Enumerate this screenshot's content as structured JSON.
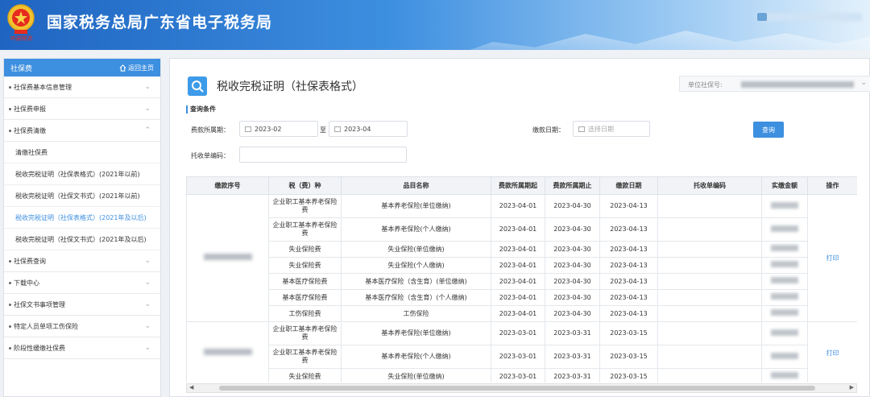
{
  "header": {
    "site_title": "国家税务总局广东省电子税务局",
    "emblem_sub": "中国税务"
  },
  "sidebar": {
    "title": "社保费",
    "home_label": "返回主页",
    "items": [
      {
        "label": "社保费基本信息管理",
        "chevron": "chevron-down-icon"
      },
      {
        "label": "社保费申报",
        "chevron": "chevron-down-icon"
      },
      {
        "label": "社保费清缴",
        "chevron": "chevron-up-icon"
      }
    ],
    "sub_items": [
      {
        "label": "清缴社保费"
      },
      {
        "label": "税收完税证明（社保表格式）(2021年以前)"
      },
      {
        "label": "税收完税证明（社保文书式）(2021年以前)"
      },
      {
        "label": "税收完税证明（社保表格式）(2021年及以后)",
        "active": true
      },
      {
        "label": "税收完税证明（社保文书式）(2021年及以后)"
      }
    ],
    "items_after": [
      {
        "label": "社保费查询"
      },
      {
        "label": "下载中心"
      },
      {
        "label": "社保文书事项管理"
      },
      {
        "label": "特定人员单项工伤保险"
      },
      {
        "label": "阶段性缓缴社保费"
      }
    ]
  },
  "main": {
    "title": "税收完税证明（社保表格式）",
    "unit_label": "单位社保号:",
    "section_label": "查询条件",
    "period_label": "费款所属期：",
    "period_start": "2023-02",
    "period_to": "至",
    "period_end": "2023-04",
    "pay_date_label": "缴款日期：",
    "pay_date_placeholder": "选择日期",
    "query_button": "查询",
    "entrust_label": "托收单编码："
  },
  "table": {
    "headers": [
      "缴款序号",
      "税（费）种",
      "品目名称",
      "费款所属期起",
      "费款所属期止",
      "缴款日期",
      "托收单编码",
      "实缴金额",
      "操作"
    ],
    "print_label": "打印",
    "group1_rows": [
      {
        "tax": "企业职工基本养老保险费",
        "item": "基本养老保险(单位缴纳)",
        "start": "2023-04-01",
        "end": "2023-04-30",
        "date": "2023-04-13"
      },
      {
        "tax": "企业职工基本养老保险费",
        "item": "基本养老保险(个人缴纳)",
        "start": "2023-04-01",
        "end": "2023-04-30",
        "date": "2023-04-13"
      },
      {
        "tax": "失业保险费",
        "item": "失业保险(单位缴纳)",
        "start": "2023-04-01",
        "end": "2023-04-30",
        "date": "2023-04-13"
      },
      {
        "tax": "失业保险费",
        "item": "失业保险(个人缴纳)",
        "start": "2023-04-01",
        "end": "2023-04-30",
        "date": "2023-04-13"
      },
      {
        "tax": "基本医疗保险费",
        "item": "基本医疗保险（含生育）(单位缴纳)",
        "start": "2023-04-01",
        "end": "2023-04-30",
        "date": "2023-04-13"
      },
      {
        "tax": "基本医疗保险费",
        "item": "基本医疗保险（含生育）(个人缴纳)",
        "start": "2023-04-01",
        "end": "2023-04-30",
        "date": "2023-04-13"
      },
      {
        "tax": "工伤保险费",
        "item": "工伤保险",
        "start": "2023-04-01",
        "end": "2023-04-30",
        "date": "2023-04-13"
      }
    ],
    "group2_rows": [
      {
        "tax": "企业职工基本养老保险费",
        "item": "基本养老保险(单位缴纳)",
        "start": "2023-03-01",
        "end": "2023-03-31",
        "date": "2023-03-15"
      },
      {
        "tax": "企业职工基本养老保险费",
        "item": "基本养老保险(个人缴纳)",
        "start": "2023-03-01",
        "end": "2023-03-31",
        "date": "2023-03-15"
      },
      {
        "tax": "失业保险费",
        "item": "失业保险(单位缴纳)",
        "start": "2023-03-01",
        "end": "2023-03-31",
        "date": "2023-03-15"
      }
    ]
  },
  "colors": {
    "accent": "#3d8fe0",
    "header_dark": "#1f64c1",
    "emblem_red": "#e62b1e"
  }
}
